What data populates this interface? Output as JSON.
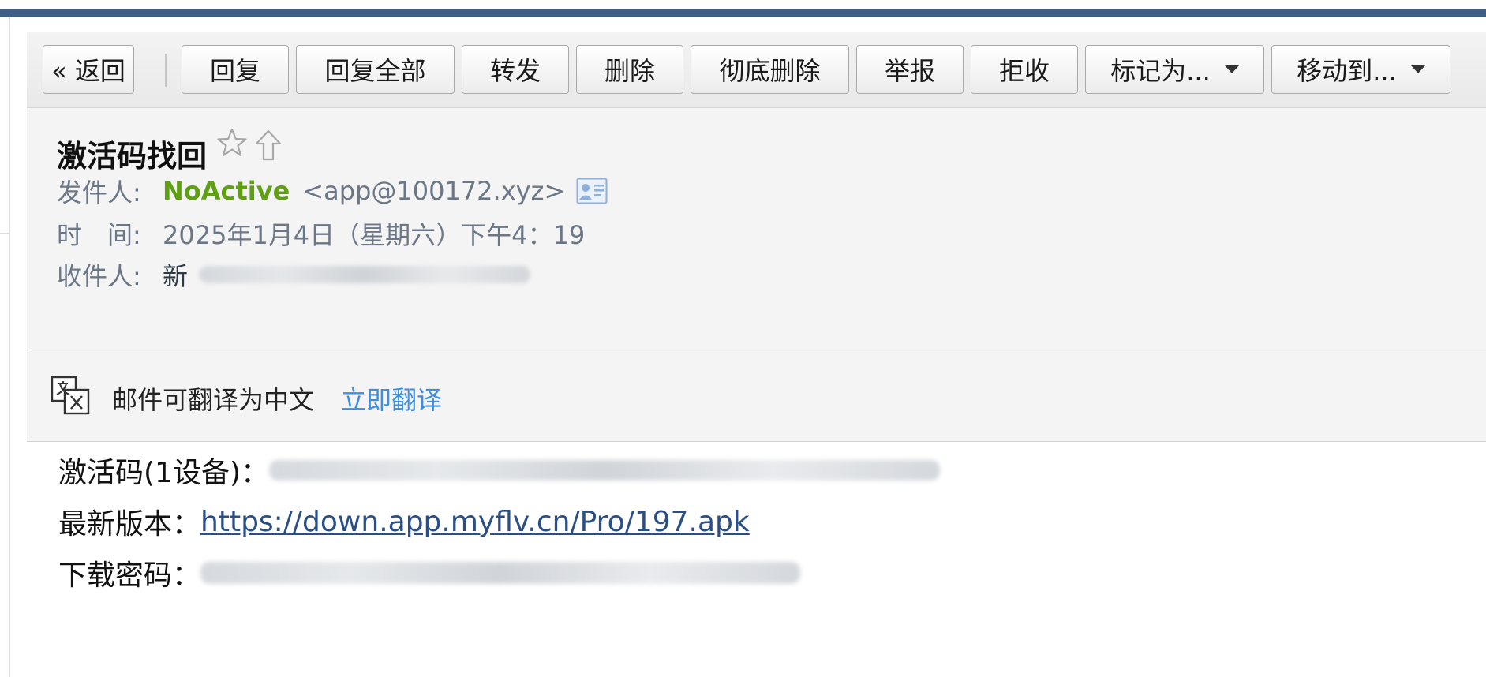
{
  "toolbar": {
    "back": "« 返回",
    "reply": "回复",
    "reply_all": "回复全部",
    "forward": "转发",
    "delete": "删除",
    "delete_permanent": "彻底删除",
    "report": "举报",
    "reject": "拒收",
    "mark_as": "标记为...",
    "move_to": "移动到..."
  },
  "email": {
    "subject": "激活码找回",
    "sender_label": "发件人:",
    "sender_name": "NoActive",
    "sender_addr": "<app@100172.xyz>",
    "time_label": "时　间:",
    "time_value": "2025年1月4日（星期六）下午4：19",
    "recipient_label": "收件人:",
    "recipient_name": "新"
  },
  "translate": {
    "text": "邮件可翻译为中文",
    "link": "立即翻译"
  },
  "body": {
    "code_label": "激活码(1设备)：",
    "version_label": "最新版本：",
    "version_link": "https://down.app.myflv.cn/Pro/197.apk",
    "password_label": "下载密码："
  },
  "colors": {
    "top_bar": "#3d5f86",
    "sender_name": "#5ea012",
    "link": "#3a8ee6",
    "body_link": "#2a4f86"
  },
  "icons": [
    "star-icon",
    "flag-icon",
    "contact-card-icon",
    "translate-icon"
  ]
}
